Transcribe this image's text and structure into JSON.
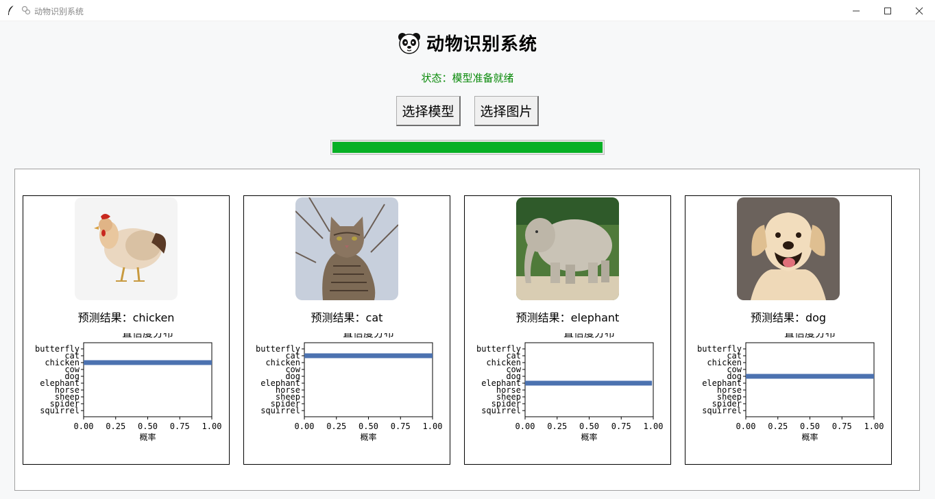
{
  "window": {
    "title": "动物识别系统"
  },
  "header": {
    "title": "动物识别系统",
    "icon": "panda-icon"
  },
  "status": {
    "text": "状态：模型准备就绪",
    "color": "#0a8a0a"
  },
  "buttons": {
    "select_model": "选择模型",
    "select_image": "选择图片"
  },
  "progress": {
    "value": 100,
    "color": "#06b025"
  },
  "results": [
    {
      "prediction": "预测结果：chicken",
      "image": "chicken-photo"
    },
    {
      "prediction": "预测结果：cat",
      "image": "cat-photo"
    },
    {
      "prediction": "预测结果：elephant",
      "image": "elephant-photo"
    },
    {
      "prediction": "预测结果：dog",
      "image": "dog-photo"
    }
  ],
  "chart_data": [
    {
      "type": "bar",
      "title": "置信度分布",
      "xlabel": "概率",
      "ylabel": "",
      "xlim": [
        0,
        1
      ],
      "xticks": [
        "0.00",
        "0.25",
        "0.50",
        "0.75",
        "1.00"
      ],
      "categories": [
        "butterfly",
        "cat",
        "chicken",
        "cow",
        "dog",
        "elephant",
        "horse",
        "sheep",
        "spider",
        "squirrel"
      ],
      "values": [
        0,
        0,
        1.0,
        0,
        0,
        0,
        0,
        0,
        0,
        0
      ],
      "color": "#4c72b0",
      "orientation": "horizontal"
    },
    {
      "type": "bar",
      "title": "置信度分布",
      "xlabel": "概率",
      "ylabel": "",
      "xlim": [
        0,
        1
      ],
      "xticks": [
        "0.00",
        "0.25",
        "0.50",
        "0.75",
        "1.00"
      ],
      "categories": [
        "butterfly",
        "cat",
        "chicken",
        "cow",
        "dog",
        "elephant",
        "horse",
        "sheep",
        "spider",
        "squirrel"
      ],
      "values": [
        0,
        1.0,
        0,
        0,
        0,
        0,
        0,
        0,
        0,
        0
      ],
      "color": "#4c72b0",
      "orientation": "horizontal"
    },
    {
      "type": "bar",
      "title": "置信度分布",
      "xlabel": "概率",
      "ylabel": "",
      "xlim": [
        0,
        1
      ],
      "xticks": [
        "0.00",
        "0.25",
        "0.50",
        "0.75",
        "1.00"
      ],
      "categories": [
        "butterfly",
        "cat",
        "chicken",
        "cow",
        "dog",
        "elephant",
        "horse",
        "sheep",
        "spider",
        "squirrel"
      ],
      "values": [
        0,
        0,
        0,
        0,
        0,
        0.99,
        0,
        0,
        0,
        0
      ],
      "color": "#4c72b0",
      "orientation": "horizontal"
    },
    {
      "type": "bar",
      "title": "置信度分布",
      "xlabel": "概率",
      "ylabel": "",
      "xlim": [
        0,
        1
      ],
      "xticks": [
        "0.00",
        "0.25",
        "0.50",
        "0.75",
        "1.00"
      ],
      "categories": [
        "butterfly",
        "cat",
        "chicken",
        "cow",
        "dog",
        "elephant",
        "horse",
        "sheep",
        "spider",
        "squirrel"
      ],
      "values": [
        0,
        0,
        0,
        0,
        1.0,
        0,
        0,
        0,
        0,
        0
      ],
      "color": "#4c72b0",
      "orientation": "horizontal"
    }
  ]
}
